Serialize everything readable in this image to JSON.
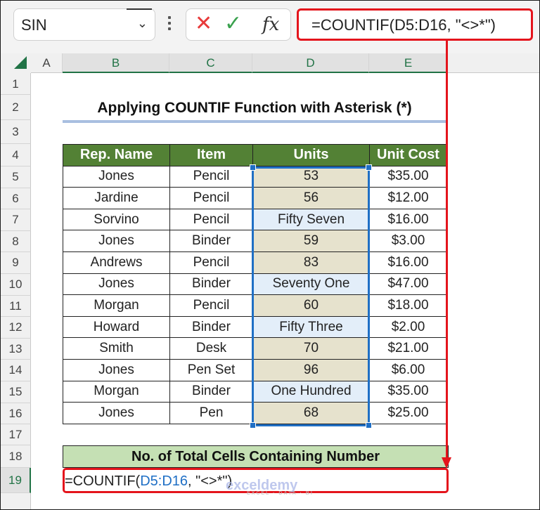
{
  "formula_bar": {
    "name_box": "SIN",
    "cancel_icon": "x-icon",
    "enter_icon": "check-icon",
    "function_icon": "fx-icon",
    "formula": "=COUNTIF(D5:D16, \"<>*\")"
  },
  "columns": [
    "A",
    "B",
    "C",
    "D",
    "E"
  ],
  "rows": [
    "1",
    "2",
    "3",
    "4",
    "5",
    "6",
    "7",
    "8",
    "9",
    "10",
    "11",
    "12",
    "13",
    "14",
    "15",
    "16",
    "17",
    "18",
    "19"
  ],
  "title": "Applying COUNTIF Function with Asterisk (*)",
  "table": {
    "headers": [
      "Rep. Name",
      "Item",
      "Units",
      "Unit Cost"
    ],
    "rows": [
      [
        "Jones",
        "Pencil",
        "53",
        "$35.00"
      ],
      [
        "Jardine",
        "Pencil",
        "56",
        "$12.00"
      ],
      [
        "Sorvino",
        "Pencil",
        "Fifty Seven",
        "$16.00"
      ],
      [
        "Jones",
        "Binder",
        "59",
        "$3.00"
      ],
      [
        "Andrews",
        "Pencil",
        "83",
        "$16.00"
      ],
      [
        "Jones",
        "Binder",
        "Seventy One",
        "$47.00"
      ],
      [
        "Morgan",
        "Pencil",
        "60",
        "$18.00"
      ],
      [
        "Howard",
        "Binder",
        "Fifty Three",
        "$2.00"
      ],
      [
        "Smith",
        "Desk",
        "70",
        "$21.00"
      ],
      [
        "Jones",
        "Pen Set",
        "96",
        "$6.00"
      ],
      [
        "Morgan",
        "Binder",
        "One Hundred",
        "$35.00"
      ],
      [
        "Jones",
        "Pen",
        "68",
        "$25.00"
      ]
    ]
  },
  "result": {
    "header": "No. of Total Cells Containing Number",
    "formula_prefix": "=COUNTIF(",
    "formula_ref": "D5:D16",
    "formula_suffix": ", \"<>*\")"
  },
  "watermark": {
    "brand": "exceldemy",
    "tagline": "EXCEL · DATA · BI"
  }
}
